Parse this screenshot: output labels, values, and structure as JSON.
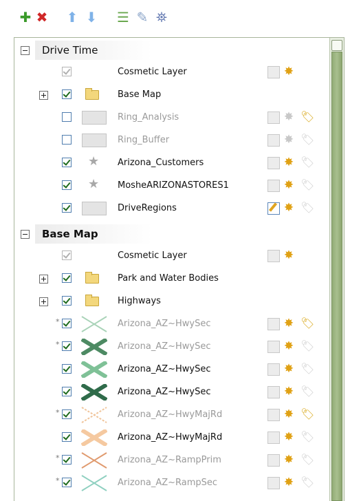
{
  "toolbar": {
    "buttons": [
      {
        "name": "add-layer-button",
        "icon": "plus-icon",
        "color": "#3a9a2a"
      },
      {
        "name": "remove-layer-button",
        "icon": "x-icon",
        "color": "#d02828"
      },
      {
        "name": "move-up-button",
        "icon": "arrow-up-icon",
        "color": "#7fb2e8"
      },
      {
        "name": "move-down-button",
        "icon": "arrow-down-icon",
        "color": "#7fb2e8"
      },
      {
        "name": "layers-button",
        "icon": "layers-icon",
        "color": "#6aa84f"
      },
      {
        "name": "properties-button",
        "icon": "properties-icon",
        "color": "#8aa4c8"
      },
      {
        "name": "map-button",
        "icon": "map-icon",
        "color": "#6a7fb5"
      }
    ]
  },
  "groups": [
    {
      "title": "Drive Time",
      "bold": false,
      "layers": [
        {
          "label": "Cosmetic Layer",
          "kind": "cosmetic"
        },
        {
          "label": "Base Map",
          "kind": "folder",
          "checked": true
        },
        {
          "label": "Ring_Analysis",
          "kind": "polygon",
          "checked": false,
          "dim": true,
          "tag": true
        },
        {
          "label": "Ring_Buffer",
          "kind": "polygon",
          "checked": false,
          "dim": true
        },
        {
          "label": "Arizona_Customers",
          "kind": "point",
          "checked": true
        },
        {
          "label": "MosheARIZONASTORES1",
          "kind": "point",
          "checked": true
        },
        {
          "label": "DriveRegions",
          "kind": "polygon",
          "checked": true,
          "editActive": true
        }
      ]
    },
    {
      "title": "Base Map",
      "bold": true,
      "layers": [
        {
          "label": "Cosmetic Layer",
          "kind": "cosmetic"
        },
        {
          "label": "Park and Water Bodies",
          "kind": "folder",
          "checked": true
        },
        {
          "label": "Highways",
          "kind": "folder",
          "checked": true
        },
        {
          "label": "Arizona_AZ~HwySec",
          "kind": "line",
          "checked": true,
          "dim": true,
          "asterisk": true,
          "color": "#a9d3b8",
          "thick": false,
          "tag": true
        },
        {
          "label": "Arizona_AZ~HwySec",
          "kind": "line",
          "checked": true,
          "dim": true,
          "asterisk": true,
          "color": "#4d8a63",
          "thick": true
        },
        {
          "label": "Arizona_AZ~HwySec",
          "kind": "line",
          "checked": true,
          "color": "#7fc197",
          "thick": true
        },
        {
          "label": "Arizona_AZ~HwySec",
          "kind": "line",
          "checked": true,
          "color": "#2f6b4a",
          "thick": true
        },
        {
          "label": "Arizona_AZ~HwyMajRd",
          "kind": "line",
          "checked": true,
          "dim": true,
          "asterisk": true,
          "color": "#f0c49a",
          "thick": false,
          "dashed": true,
          "tag": true
        },
        {
          "label": "Arizona_AZ~HwyMajRd",
          "kind": "line",
          "checked": true,
          "color": "#f5c9a0",
          "thick": true
        },
        {
          "label": "Arizona_AZ~RampPrim",
          "kind": "line",
          "checked": true,
          "dim": true,
          "asterisk": true,
          "color": "#e09a6e",
          "thick": false
        },
        {
          "label": "Arizona_AZ~RampSec",
          "kind": "line",
          "checked": true,
          "dim": true,
          "asterisk": true,
          "color": "#8fd0c0",
          "thick": false
        }
      ]
    }
  ]
}
